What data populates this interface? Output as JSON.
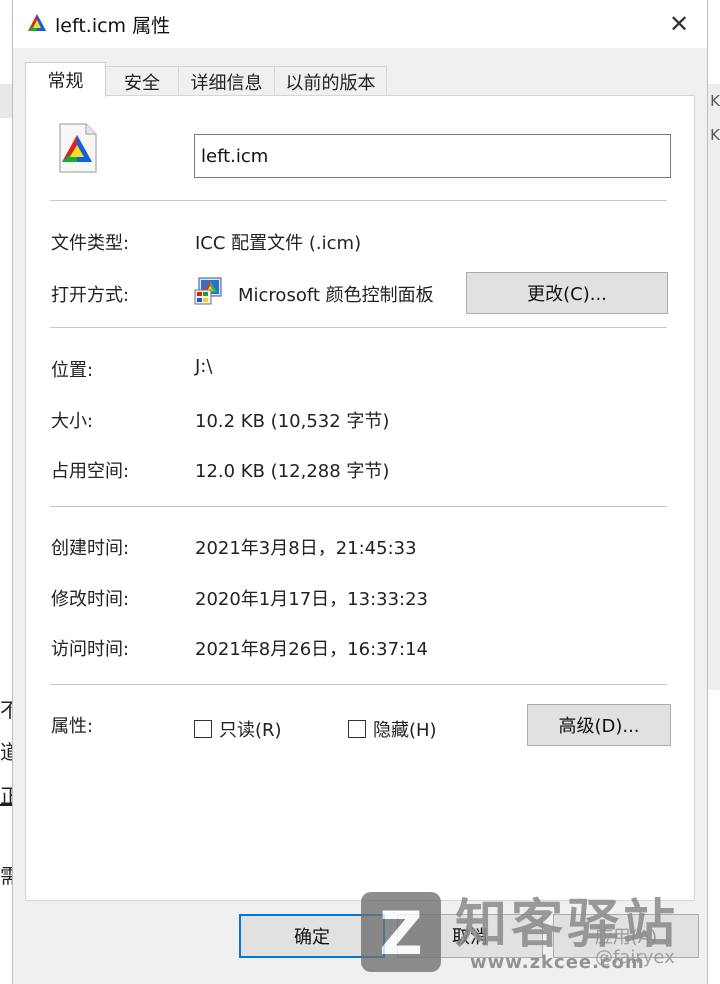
{
  "window": {
    "title": "left.icm 属性",
    "close_glyph": "✕"
  },
  "tabs": [
    {
      "label": "常规",
      "active": true
    },
    {
      "label": "安全",
      "active": false
    },
    {
      "label": "详细信息",
      "active": false
    },
    {
      "label": "以前的版本",
      "active": false
    }
  ],
  "general": {
    "filename": "left.icm",
    "rows": {
      "type": {
        "label": "文件类型:",
        "value": "ICC 配置文件 (.icm)"
      },
      "opens_with": {
        "label": "打开方式:",
        "value": "Microsoft 颜色控制面板",
        "button": "更改(C)..."
      },
      "location": {
        "label": "位置:",
        "value": "J:\\"
      },
      "size": {
        "label": "大小:",
        "value": "10.2 KB (10,532 字节)"
      },
      "disk_size": {
        "label": "占用空间:",
        "value": "12.0 KB (12,288 字节)"
      },
      "created": {
        "label": "创建时间:",
        "value": "2021年3月8日，21:45:33"
      },
      "modified": {
        "label": "修改时间:",
        "value": "2020年1月17日，13:33:23"
      },
      "accessed": {
        "label": "访问时间:",
        "value": "2021年8月26日，16:37:14"
      }
    },
    "attributes": {
      "label": "属性:",
      "readonly": {
        "label": "只读(R)",
        "checked": false
      },
      "hidden": {
        "label": "隐藏(H)",
        "checked": false
      },
      "advanced_button": "高级(D)..."
    }
  },
  "footer": {
    "ok": "确定",
    "cancel": "取消",
    "apply": "应用(A)"
  },
  "background": {
    "left_fragments": [
      "不",
      "道",
      "正",
      "需"
    ],
    "right_fragments": [
      "K",
      "K"
    ]
  },
  "watermark": {
    "title": "知客驿站",
    "url": "www.zkcee.com",
    "credit": "@fairyex",
    "logo_letter": "Z"
  }
}
